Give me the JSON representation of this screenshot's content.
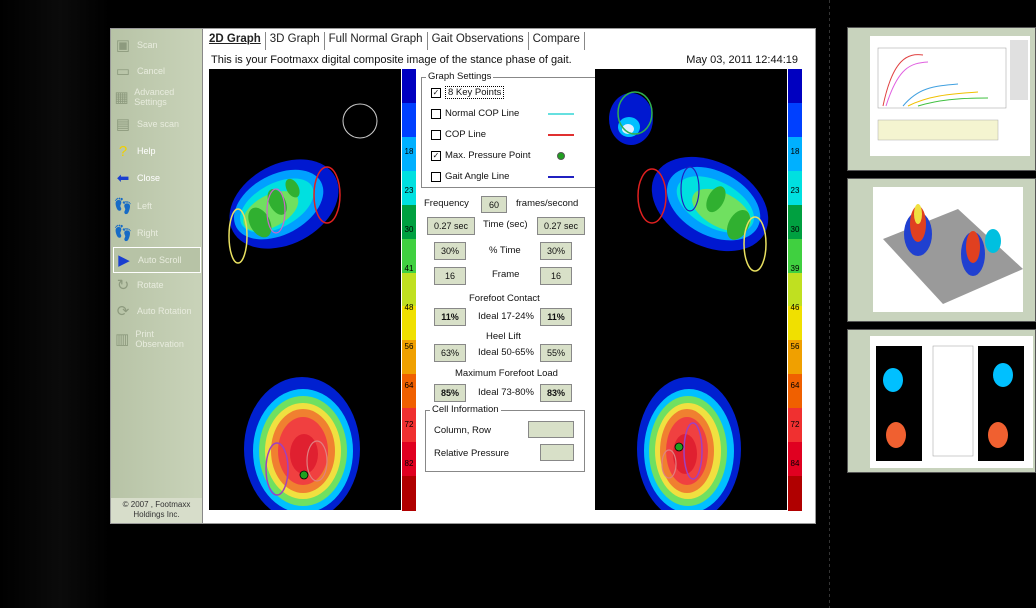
{
  "toolbar": {
    "buttons": [
      {
        "label": "Scan",
        "icon": "scan-icon",
        "glyph": "▣"
      },
      {
        "label": "Cancel",
        "icon": "cancel-icon",
        "glyph": "▭"
      },
      {
        "label": "Advanced Settings",
        "icon": "advanced-settings-icon",
        "glyph": "▦"
      },
      {
        "label": "Save scan",
        "icon": "save-scan-icon",
        "glyph": "▤"
      },
      {
        "label": "Help",
        "icon": "help-icon",
        "glyph": "?"
      },
      {
        "label": "Close",
        "icon": "close-icon",
        "glyph": "⬅"
      },
      {
        "label": "Left",
        "icon": "left-foot-icon",
        "glyph": "👣"
      },
      {
        "label": "Right",
        "icon": "right-foot-icon",
        "glyph": "👣"
      },
      {
        "label": "Auto Scroll",
        "icon": "auto-scroll-icon",
        "glyph": "▶"
      },
      {
        "label": "Rotate",
        "icon": "rotate-icon",
        "glyph": "↻"
      },
      {
        "label": "Auto Rotation",
        "icon": "auto-rotation-icon",
        "glyph": "⟳"
      },
      {
        "label": "Print Observation",
        "icon": "print-icon",
        "glyph": "▥"
      }
    ],
    "copyright": "© 2007 , Footmaxx Holdings Inc."
  },
  "tabs": [
    "2D Graph",
    "3D Graph",
    "Full Normal Graph",
    "Gait Observations",
    "Compare"
  ],
  "active_tab": "2D Graph",
  "subtitle": "This is your Footmaxx digital composite image of the stance phase of gait.",
  "datetime": "May 03, 2011 12:44:19",
  "scale_labels": [
    "18",
    "23",
    "30",
    "41",
    "48",
    "56",
    "64",
    "72",
    "82"
  ],
  "scale_labels_right": [
    "18",
    "23",
    "30",
    "39",
    "46",
    "56",
    "64",
    "72",
    "84"
  ],
  "graph_settings": {
    "title": "Graph Settings",
    "items": [
      {
        "label": "8 Key Points",
        "checked": true,
        "color": ""
      },
      {
        "label": "Normal COP Line",
        "checked": false,
        "color": "#66e0e0"
      },
      {
        "label": "COP Line",
        "checked": false,
        "color": "#e03030"
      },
      {
        "label": "Max. Pressure Point",
        "checked": true,
        "color": "#20a020"
      },
      {
        "label": "Gait Angle Line",
        "checked": false,
        "color": "#2020c0"
      }
    ]
  },
  "frequency": {
    "label": "Frequency",
    "value": "60",
    "unit": "frames/second"
  },
  "time": {
    "label": "Time (sec)",
    "left": "0.27 sec",
    "right": "0.27 sec"
  },
  "pct_time": {
    "label": "% Time",
    "left": "30%",
    "right": "30%"
  },
  "frame": {
    "label": "Frame",
    "left": "16",
    "right": "16"
  },
  "forefoot_contact": {
    "title": "Forefoot Contact",
    "ideal": "Ideal 17-24%",
    "left": "11%",
    "right": "11%"
  },
  "heel_lift": {
    "title": "Heel Lift",
    "ideal": "Ideal 50-65%",
    "left": "63%",
    "right": "55%"
  },
  "max_forefoot_load": {
    "title": "Maximum Forefoot Load",
    "ideal": "Ideal 73-80%",
    "left": "85%",
    "right": "83%"
  },
  "cell_info": {
    "title": "Cell Information",
    "col_row": "Column, Row",
    "rel_pressure": "Relative Pressure"
  }
}
